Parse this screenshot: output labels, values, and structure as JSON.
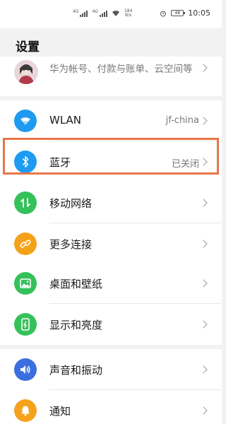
{
  "status_bar": {
    "signal_tag_1": "4G",
    "signal_tag_2": "4G",
    "speed_value": "184",
    "speed_unit": "B/s",
    "battery": "48",
    "time": "10:05"
  },
  "page": {
    "title": "设置"
  },
  "account": {
    "text": "华为帐号、付款与账单、云空间等"
  },
  "colors": {
    "wlan": "#1e9bf0",
    "bluetooth": "#1e9bf0",
    "mobile_network": "#35c15a",
    "more_connections": "#f5a21b",
    "desktop_wallpaper": "#35c15a",
    "display_brightness": "#35c15a",
    "sound_vibration": "#3b6fe0",
    "notifications": "#f5a21b",
    "highlight": "#e8754a"
  },
  "items": [
    {
      "id": "wlan",
      "label": "WLAN",
      "value": "jf-china",
      "icon": "wifi-icon"
    },
    {
      "id": "bluetooth",
      "label": "蓝牙",
      "value": "已关闭",
      "icon": "bluetooth-icon"
    },
    {
      "id": "mobile_network",
      "label": "移动网络",
      "value": "",
      "icon": "mobile-data-icon"
    },
    {
      "id": "more_connections",
      "label": "更多连接",
      "value": "",
      "icon": "link-icon"
    },
    {
      "id": "desktop_wallpaper",
      "label": "桌面和壁纸",
      "value": "",
      "icon": "image-icon"
    },
    {
      "id": "display_brightness",
      "label": "显示和亮度",
      "value": "",
      "icon": "phone-display-icon"
    },
    {
      "id": "sound_vibration",
      "label": "声音和振动",
      "value": "",
      "icon": "speaker-icon"
    },
    {
      "id": "notifications",
      "label": "通知",
      "value": "",
      "icon": "bell-icon"
    }
  ]
}
